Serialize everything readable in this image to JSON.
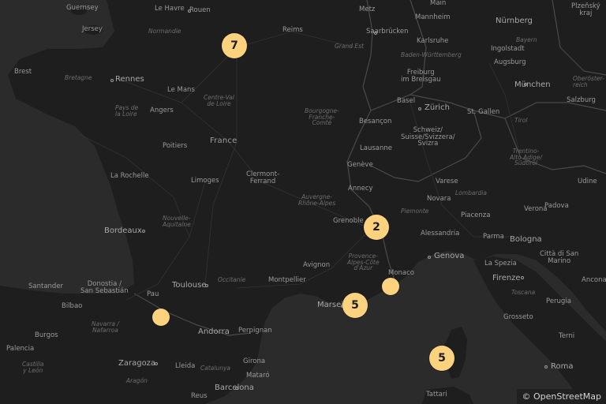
{
  "map": {
    "attribution": "© OpenStreetMap",
    "colors": {
      "sea": "#2b2b2c",
      "land": "#1e1e1f",
      "border": "#4a4a4a",
      "marker": "#fcd27e"
    }
  },
  "labels": {
    "guernsey": "Guernsey",
    "jersey": "Jersey",
    "brest": "Brest",
    "bretagne": "Bretagne",
    "rennes": "Rennes",
    "le_havre": "Le Havre",
    "rouen": "Rouen",
    "normandie": "Normandie",
    "le_mans": "Le Mans",
    "centre": "Centre-Val\nde Loire",
    "pays_loire": "Pays de\nla Loire",
    "angers": "Angers",
    "france": "France",
    "poitiers": "Poitiers",
    "la_rochelle": "La Rochelle",
    "limoges": "Limoges",
    "clermont": "Clermont-\nFerrand",
    "nouvelle": "Nouvelle-\nAquitaine",
    "bordeaux": "Bordeaux",
    "reims": "Reims",
    "grand_est": "Grand Est",
    "metz": "Metz",
    "saarbrucken": "Saarbrücken",
    "karlsruhe": "Karlsruhe",
    "mannheim": "Mannheim",
    "nurnberg": "Nürnberg",
    "bayern": "Bayern",
    "ingolstadt": "Ingolstadt",
    "augsburg": "Augsburg",
    "munchen": "München",
    "oberosterreich": "Oberöster-\nreich",
    "salzburg": "Salzburg",
    "baden": "Baden-Württemberg",
    "freiburg": "Freiburg\nim Breisgau",
    "basel": "Basel",
    "zurich": "Zürich",
    "st_gallen": "St. Gallen",
    "tirol": "Tirol",
    "besancon": "Besançon",
    "bourgogne": "Bourgogne-\nFranche-\nComté",
    "schweiz": "Schweiz/\nSuisse/Svizzera/\nSvizra",
    "lausanne": "Lausanne",
    "geneve": "Genève",
    "trentino": "Trentino-\nAlto Adige/\nSüdtirol",
    "udine": "Udine",
    "annecy": "Annecy",
    "varese": "Varese",
    "novara": "Novara",
    "lombardia": "Lombardia",
    "auvergne": "Auvergne-\nRhône-Alpes",
    "grenoble": "Grenoble",
    "piemonte": "Piemonte",
    "piacenza": "Piacenza",
    "verona": "Verona",
    "padova": "Padova",
    "alessandria": "Alessandria",
    "parma": "Parma",
    "bologna": "Bologna",
    "genova": "Genova",
    "la_spezia": "La Spezia",
    "citta": "Città di San\nMarino",
    "firenze": "Firenze",
    "ancona": "Ancona",
    "toscana": "Toscana",
    "perugia": "Perugia",
    "grosseto": "Grosseto",
    "terni": "Terni",
    "roma": "Roma",
    "provence": "Provence-\nAlpes-Côte\nd'Azur",
    "avignon": "Avignon",
    "monaco": "Monaco",
    "montpellier": "Montpellier",
    "occitanie": "Occitanie",
    "toulouse": "Toulouse",
    "marseille": "Marseille",
    "pau": "Pau",
    "santander": "Santander",
    "donostia": "Donostia /\nSan Sebastián",
    "bilbao": "Bilbao",
    "navarra": "Navarra /\nNafarroa",
    "burgos": "Burgos",
    "andorra": "Andorra",
    "perpignan": "Perpignan",
    "palencia": "Palencia",
    "castilla": "Castilla\ny León",
    "zaragoza": "Zaragoza",
    "aragon": "Aragón",
    "lleida": "Lleida",
    "catalunya": "Catalunya",
    "girona": "Girona",
    "mataro": "Mataró",
    "barcelona": "Barcelona",
    "reus": "Reus",
    "tattari": "Tattari",
    "main": "Main",
    "plzensky": "Plzeňský\nkraj"
  },
  "clusters": [
    {
      "id": "paris",
      "count": "7"
    },
    {
      "id": "grenoble-area",
      "count": "2"
    },
    {
      "id": "monaco-area",
      "count": ""
    },
    {
      "id": "marseille-area",
      "count": "5"
    },
    {
      "id": "pau-area",
      "count": ""
    },
    {
      "id": "corsica",
      "count": "5"
    }
  ]
}
